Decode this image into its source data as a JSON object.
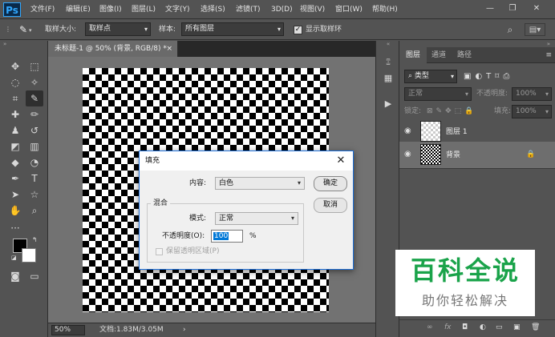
{
  "app": {
    "logo": "Ps"
  },
  "menu": [
    "文件(F)",
    "编辑(E)",
    "图像(I)",
    "图层(L)",
    "文字(Y)",
    "选择(S)",
    "滤镜(T)",
    "3D(D)",
    "视图(V)",
    "窗口(W)",
    "帮助(H)"
  ],
  "window_controls": {
    "minimize": "—",
    "restore": "❐",
    "close": "✕"
  },
  "options": {
    "sample_size_label": "取样大小:",
    "sample_size_value": "取样点",
    "sample_label": "样本:",
    "sample_value": "所有图层",
    "show_ring_label": "显示取样环",
    "show_ring_checked": true
  },
  "document": {
    "tab_title": "未标题-1 @ 50% (背景, RGB/8) *",
    "tab_close": "×",
    "zoom": "50%",
    "doc_info": "文档:1.83M/3.05M",
    "status_arrow": "›"
  },
  "layers_panel": {
    "tabs": [
      "图层",
      "通道",
      "路径"
    ],
    "filter_kind": "类型",
    "blend_mode": "正常",
    "opacity_label": "不透明度:",
    "opacity_value": "100%",
    "lock_label": "锁定:",
    "fill_label": "填充:",
    "fill_value": "100%",
    "layers": [
      {
        "name": "图层 1",
        "selected": false
      },
      {
        "name": "背景",
        "selected": true
      }
    ],
    "lock_icon_glyph": "🔒",
    "footer_icons": [
      "∞",
      "fx",
      "◘",
      "◐",
      "▭",
      "▣",
      "🗑"
    ]
  },
  "dialog": {
    "title": "填充",
    "close": "✕",
    "content_label": "内容:",
    "content_value": "白色",
    "ok_label": "确定",
    "cancel_label": "取消",
    "blend_group_label": "混合",
    "mode_label": "模式:",
    "mode_value": "正常",
    "opacity_label": "不透明度(O):",
    "opacity_value": "100",
    "opacity_unit": "%",
    "preserve_transparency_label": "保留透明区域(P)"
  },
  "watermark": {
    "title": "百科全说",
    "subtitle": "助你轻松解决"
  },
  "colors": {
    "ui_bg": "#535353",
    "dialog_bg": "#f0f0f0",
    "accent_blue": "#1c6ed8",
    "watermark_green": "#1aa34a"
  }
}
